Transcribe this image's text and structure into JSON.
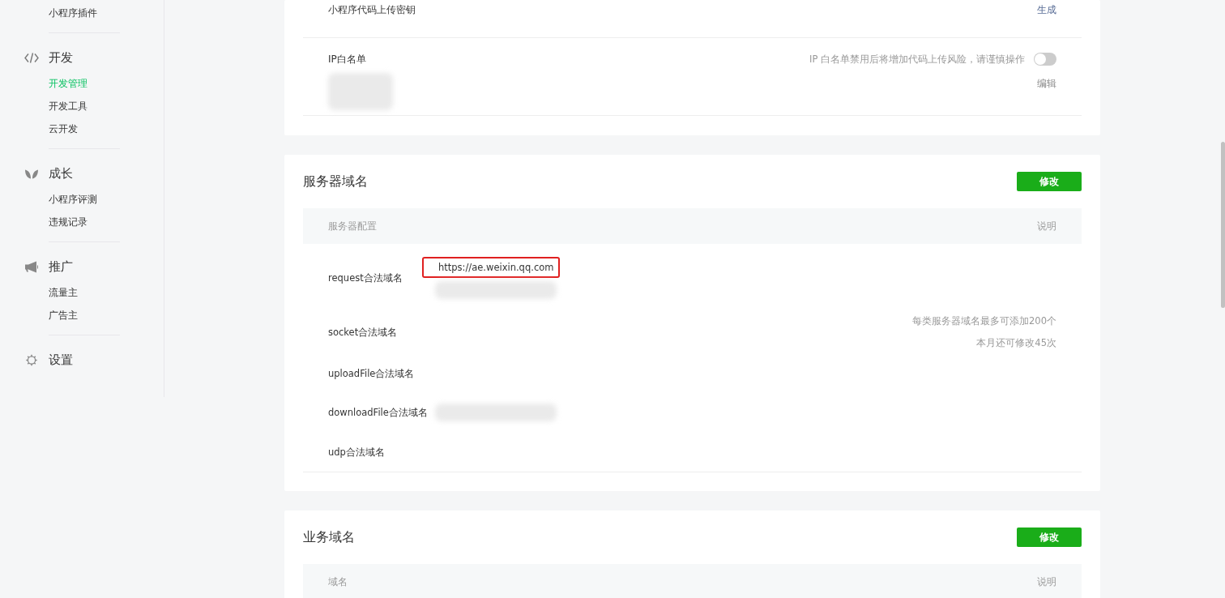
{
  "sidebar": {
    "groups": [
      {
        "items": [
          {
            "label": "小程序插件",
            "selected": false
          }
        ]
      },
      {
        "title": "开发",
        "kind": "code",
        "items": [
          {
            "label": "开发管理",
            "selected": true
          },
          {
            "label": "开发工具",
            "selected": false
          },
          {
            "label": "云开发",
            "selected": false
          }
        ]
      },
      {
        "title": "成长",
        "kind": "sprout",
        "items": [
          {
            "label": "小程序评测",
            "selected": false
          },
          {
            "label": "违规记录",
            "selected": false
          }
        ]
      },
      {
        "title": "推广",
        "kind": "megaphone",
        "items": [
          {
            "label": "流量主",
            "selected": false
          },
          {
            "label": "广告主",
            "selected": false
          }
        ]
      },
      {
        "title": "设置",
        "kind": "gear"
      }
    ]
  },
  "upload_key": {
    "label": "小程序代码上传密钥",
    "action": "生成"
  },
  "ip_whitelist": {
    "label": "IP白名单",
    "hint": "IP 白名单禁用后将增加代码上传风险，请谨慎操作",
    "on": false,
    "action": "编辑",
    "redacted": true
  },
  "server_domains": {
    "title": "服务器域名",
    "button": "修改",
    "columns": [
      "服务器配置",
      "说明"
    ],
    "rows": [
      {
        "label": "request合法域名",
        "values": [
          {
            "text": "https://ae.weixin.qq.com",
            "highlighted": true
          }
        ],
        "redacted": true
      },
      {
        "label": "socket合法域名",
        "notes": [
          "每类服务器域名最多可添加200个",
          "本月还可修改45次"
        ]
      },
      {
        "label": "uploadFile合法域名"
      },
      {
        "label": "downloadFile合法域名",
        "redacted": true
      },
      {
        "label": "udp合法域名"
      }
    ]
  },
  "business_domains": {
    "title": "业务域名",
    "button": "修改",
    "columns": [
      "域名",
      "说明"
    ]
  }
}
